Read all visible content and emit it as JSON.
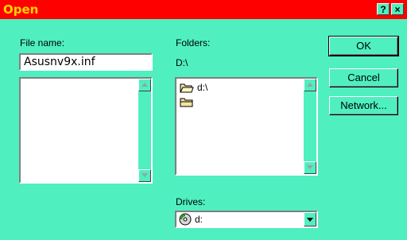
{
  "window": {
    "title": "Open",
    "help_label": "?",
    "close_label": "×"
  },
  "file_name": {
    "label": "File name:",
    "value": "Asusnv9x.inf"
  },
  "folders": {
    "label": "Folders:",
    "current_path": "D:\\",
    "items": [
      {
        "label": "d:\\",
        "icon": "open-folder-icon"
      },
      {
        "label": "",
        "icon": "closed-folder-icon"
      }
    ]
  },
  "drives": {
    "label": "Drives:",
    "selected": "d:",
    "icon": "cd-drive-icon"
  },
  "buttons": {
    "ok": "OK",
    "cancel": "Cancel",
    "network": "Network..."
  },
  "colors": {
    "dialog_background": "#4fefc0",
    "title_bar": "#ff0000",
    "title_text": "#ffd400"
  }
}
